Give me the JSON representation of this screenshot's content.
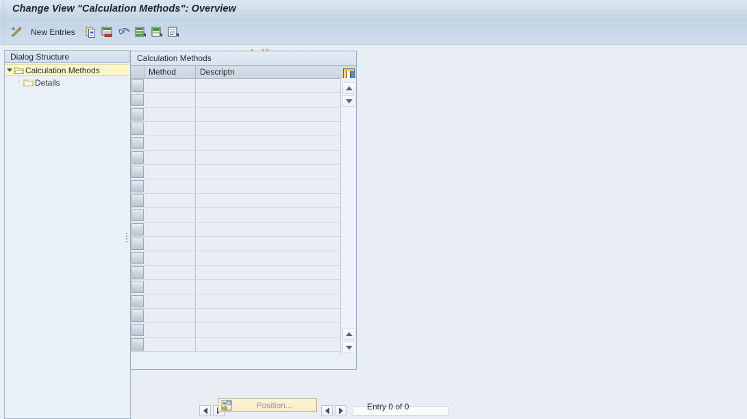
{
  "window": {
    "title": "Change View \"Calculation Methods\": Overview"
  },
  "toolbar": {
    "items": [
      {
        "name": "display-change-icon",
        "icon": "pencil-icon",
        "label": ""
      },
      {
        "name": "new-entries-button",
        "icon": "",
        "label": "New Entries"
      },
      {
        "name": "copy-as-button",
        "icon": "copy-icon",
        "label": ""
      },
      {
        "name": "delete-button",
        "icon": "delete-row-icon",
        "label": ""
      },
      {
        "name": "undo-button",
        "icon": "undo-arrow-icon",
        "label": ""
      },
      {
        "name": "select-all-button",
        "icon": "select-all-icon",
        "label": ""
      },
      {
        "name": "select-block-button",
        "icon": "select-block-icon",
        "label": ""
      },
      {
        "name": "deselect-all-button",
        "icon": "deselect-all-icon",
        "label": ""
      }
    ],
    "watermark": "www.tutorialkart.com"
  },
  "sidebar": {
    "header": "Dialog Structure",
    "items": [
      {
        "label": "Calculation Methods",
        "icon": "open-folder-icon",
        "selected": true,
        "expanded": true,
        "level": 0
      },
      {
        "label": "Details",
        "icon": "closed-folder-icon",
        "selected": false,
        "expanded": false,
        "level": 1
      }
    ]
  },
  "table": {
    "title": "Calculation Methods",
    "columns": [
      "Method",
      "Descriptn"
    ],
    "rows": [],
    "visible_empty_rows": 19,
    "config_icon": "column-config-icon"
  },
  "scrollbars": {
    "up_arrow": "scroll-up-icon",
    "down_arrow": "scroll-down-icon",
    "left_arrow": "scroll-left-icon",
    "right_arrow": "scroll-right-icon"
  },
  "footer": {
    "position_button": "Position...",
    "position_icon": "position-icon",
    "entry_status": "Entry 0 of 0"
  },
  "colors": {
    "title_bar": "#cedcea",
    "toolbar": "#c8d8e8",
    "panel_bg": "#eaf0f7",
    "row_bg": "#e9eef6",
    "selected_tree_row": "#fcf7c8",
    "watermark": "#dcac79",
    "button_yellow": "#f6ecc4"
  }
}
